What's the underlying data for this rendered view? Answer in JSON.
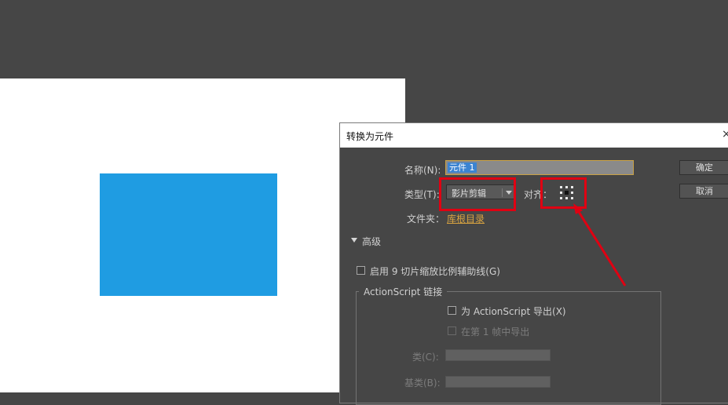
{
  "dialog": {
    "title": "转换为元件",
    "close_glyph": "×",
    "name_label": "名称(N):",
    "name_value": "元件 1",
    "type_label": "类型(T):",
    "type_value": "影片剪辑",
    "align_label": "对齐：",
    "folder_label": "文件夹：",
    "folder_link": "库根目录",
    "ok_button": "确定",
    "cancel_button": "取消",
    "advanced_label": "高级",
    "enable_9slice_label": "启用 9 切片缩放比例辅助线(G)",
    "actionscript_group_title": "ActionScript 链接",
    "export_for_as_label": "为 ActionScript 导出(X)",
    "export_in_frame1_label": "在第 1 帧中导出",
    "class_label": "类(C):",
    "base_class_label": "基类(B):"
  },
  "colors": {
    "canvas_bg": "#464646",
    "stage_bg": "#ffffff",
    "shape_fill": "#1f9ce2",
    "highlight_red": "#e00012",
    "link_orange": "#d9a441"
  }
}
